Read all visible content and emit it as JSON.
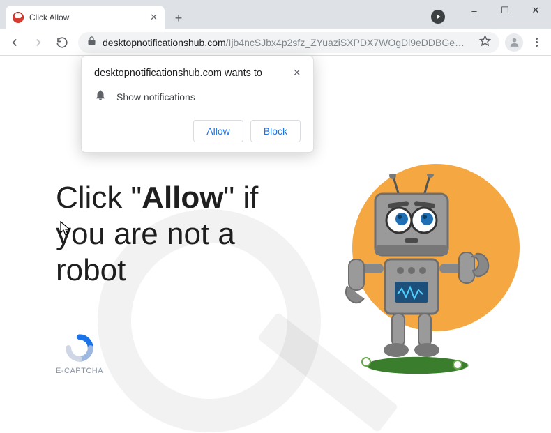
{
  "tab": {
    "title": "Click Allow"
  },
  "window_controls": {
    "minimize": "–",
    "maximize": "☐",
    "close": "✕"
  },
  "omnibox": {
    "host": "desktopnotificationshub.com",
    "path": "/Ijb4ncSJbx4p2sfz_ZYuaziSXPDX7WOgDl9eDDBGe…"
  },
  "permission": {
    "title": "desktopnotificationshub.com wants to",
    "item": "Show notifications",
    "allow": "Allow",
    "block": "Block"
  },
  "hero": {
    "prefix": "Click \"",
    "bold": "Allow",
    "suffix": "\" if you are not a robot"
  },
  "captcha": {
    "label": "E-CAPTCHA"
  }
}
